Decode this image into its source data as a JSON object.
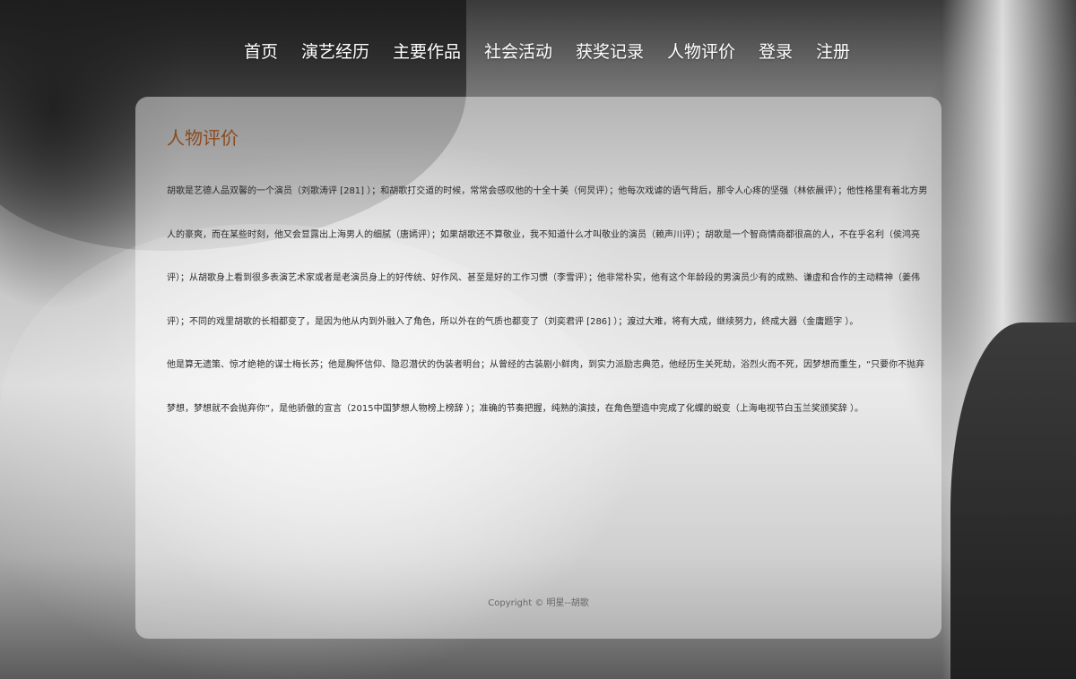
{
  "nav": {
    "items": [
      {
        "label": "首页"
      },
      {
        "label": "演艺经历"
      },
      {
        "label": "主要作品"
      },
      {
        "label": "社会活动"
      },
      {
        "label": "获奖记录"
      },
      {
        "label": "人物评价"
      },
      {
        "label": "登录"
      },
      {
        "label": "注册"
      }
    ]
  },
  "content": {
    "title": "人物评价",
    "paragraphs": [
      "胡歌是艺德人品双馨的一个演员（刘歌涛评 [281] ）；和胡歌打交道的时候，常常会感叹他的十全十美（何炅评）；他每次戏谑的语气背后，那令人心疼的坚强（林依晨评）；他性格里有着北方男人的豪爽，而在某些时刻，他又会显露出上海男人的细腻（唐嫣评）；如果胡歌还不算敬业，我不知道什么才叫敬业的演员（赖声川评）；胡歌是一个智商情商都很高的人，不在乎名利（侯鸿亮评）；从胡歌身上看到很多表演艺术家或者是老演员身上的好传统、好作风、甚至是好的工作习惯（李雪评）；他非常朴实，他有这个年龄段的男演员少有的成熟、谦虚和合作的主动精神（姜伟评）；不同的戏里胡歌的长相都变了，是因为他从内到外融入了角色，所以外在的气质也都变了（刘奕君评 [286] ）；渡过大难，将有大成，继续努力，终成大器（金庸题字 ）。",
      "他是算无遗策、惊才绝艳的谋士梅长苏；他是胸怀信仰、隐忍潜伏的伪装者明台；从曾经的古装剧小鲜肉，到实力派励志典范，他经历生关死劫，浴烈火而不死，因梦想而重生，“只要你不抛弃梦想，梦想就不会抛弃你”，是他骄傲的宣言（2015中国梦想人物榜上榜辞 ）；准确的节奏把握，纯熟的演技，在角色塑造中完成了化蝶的蜕变（上海电视节白玉兰奖颁奖辞 ）。"
    ]
  },
  "footer": {
    "copyright": "Copyright © 明星--胡歌"
  }
}
